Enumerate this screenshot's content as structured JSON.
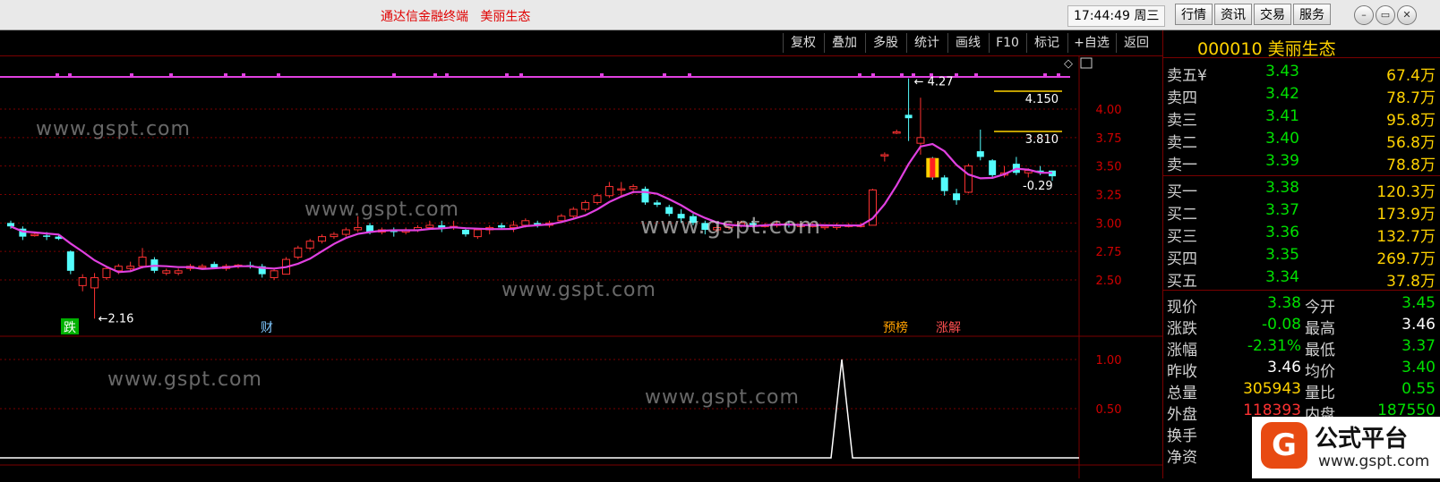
{
  "window": {
    "title": "通达信金融终端   美丽生态",
    "clock": "17:44:49 周三",
    "nav_buttons": [
      "行情",
      "资讯",
      "交易",
      "服务"
    ]
  },
  "toolbar": {
    "buttons": [
      "复权",
      "叠加",
      "多股",
      "统计",
      "画线",
      "F10",
      "标记",
      "+自选",
      "返回"
    ]
  },
  "chart": {
    "price_axis": [
      "4.00",
      "3.75",
      "3.50",
      "3.25",
      "3.00",
      "2.75",
      "2.50"
    ],
    "sub_axis": [
      "1.00",
      "0.50"
    ],
    "annotations": {
      "high": "4.27",
      "low": "2.16",
      "level_upper": "4.150",
      "level_lower": "3.810",
      "change": "-0.29"
    },
    "markers": [
      "跌",
      "财",
      "预榜",
      "涨解"
    ],
    "watermark": "www.gspt.com",
    "colors": {
      "up": "#ff3232",
      "down": "#54fcfc",
      "ma": "#e040e0",
      "grid": "#7a0000"
    }
  },
  "chart_data": {
    "type": "candlestick",
    "ylim": [
      2.25,
      4.35
    ],
    "candles": [
      {
        "o": 3.0,
        "h": 3.02,
        "l": 2.95,
        "c": 2.97
      },
      {
        "o": 2.95,
        "h": 2.97,
        "l": 2.85,
        "c": 2.88
      },
      {
        "o": 2.9,
        "h": 2.92,
        "l": 2.88,
        "c": 2.9
      },
      {
        "o": 2.89,
        "h": 2.92,
        "l": 2.85,
        "c": 2.88
      },
      {
        "o": 2.88,
        "h": 2.9,
        "l": 2.85,
        "c": 2.86
      },
      {
        "o": 2.75,
        "h": 2.76,
        "l": 2.55,
        "c": 2.58
      },
      {
        "o": 2.45,
        "h": 2.55,
        "l": 2.4,
        "c": 2.52
      },
      {
        "o": 2.43,
        "h": 2.56,
        "l": 2.16,
        "c": 2.52
      },
      {
        "o": 2.52,
        "h": 2.62,
        "l": 2.5,
        "c": 2.6
      },
      {
        "o": 2.58,
        "h": 2.64,
        "l": 2.55,
        "c": 2.62
      },
      {
        "o": 2.6,
        "h": 2.66,
        "l": 2.58,
        "c": 2.62
      },
      {
        "o": 2.62,
        "h": 2.78,
        "l": 2.6,
        "c": 2.7
      },
      {
        "o": 2.68,
        "h": 2.7,
        "l": 2.56,
        "c": 2.58
      },
      {
        "o": 2.56,
        "h": 2.6,
        "l": 2.54,
        "c": 2.58
      },
      {
        "o": 2.56,
        "h": 2.6,
        "l": 2.54,
        "c": 2.58
      },
      {
        "o": 2.6,
        "h": 2.64,
        "l": 2.58,
        "c": 2.62
      },
      {
        "o": 2.62,
        "h": 2.64,
        "l": 2.6,
        "c": 2.62
      },
      {
        "o": 2.64,
        "h": 2.66,
        "l": 2.6,
        "c": 2.61
      },
      {
        "o": 2.6,
        "h": 2.64,
        "l": 2.58,
        "c": 2.62
      },
      {
        "o": 2.62,
        "h": 2.64,
        "l": 2.6,
        "c": 2.63
      },
      {
        "o": 2.63,
        "h": 2.66,
        "l": 2.6,
        "c": 2.62
      },
      {
        "o": 2.62,
        "h": 2.64,
        "l": 2.52,
        "c": 2.55
      },
      {
        "o": 2.52,
        "h": 2.6,
        "l": 2.5,
        "c": 2.58
      },
      {
        "o": 2.55,
        "h": 2.7,
        "l": 2.55,
        "c": 2.68
      },
      {
        "o": 2.7,
        "h": 2.8,
        "l": 2.68,
        "c": 2.78
      },
      {
        "o": 2.78,
        "h": 2.86,
        "l": 2.76,
        "c": 2.84
      },
      {
        "o": 2.84,
        "h": 2.9,
        "l": 2.82,
        "c": 2.88
      },
      {
        "o": 2.88,
        "h": 2.92,
        "l": 2.86,
        "c": 2.9
      },
      {
        "o": 2.9,
        "h": 2.96,
        "l": 2.88,
        "c": 2.94
      },
      {
        "o": 2.94,
        "h": 3.06,
        "l": 2.92,
        "c": 2.96
      },
      {
        "o": 2.98,
        "h": 3.0,
        "l": 2.9,
        "c": 2.92
      },
      {
        "o": 2.92,
        "h": 2.96,
        "l": 2.9,
        "c": 2.94
      },
      {
        "o": 2.94,
        "h": 2.96,
        "l": 2.88,
        "c": 2.92
      },
      {
        "o": 2.92,
        "h": 2.96,
        "l": 2.9,
        "c": 2.94
      },
      {
        "o": 2.94,
        "h": 2.98,
        "l": 2.92,
        "c": 2.96
      },
      {
        "o": 2.96,
        "h": 3.02,
        "l": 2.94,
        "c": 2.98
      },
      {
        "o": 2.98,
        "h": 3.02,
        "l": 2.92,
        "c": 2.96
      },
      {
        "o": 2.96,
        "h": 3.02,
        "l": 2.94,
        "c": 2.97
      },
      {
        "o": 2.94,
        "h": 2.96,
        "l": 2.88,
        "c": 2.9
      },
      {
        "o": 2.88,
        "h": 2.95,
        "l": 2.86,
        "c": 2.94
      },
      {
        "o": 2.94,
        "h": 2.98,
        "l": 2.9,
        "c": 2.96
      },
      {
        "o": 2.98,
        "h": 3.0,
        "l": 2.94,
        "c": 2.96
      },
      {
        "o": 2.96,
        "h": 3.02,
        "l": 2.92,
        "c": 2.98
      },
      {
        "o": 2.98,
        "h": 3.04,
        "l": 2.96,
        "c": 3.02
      },
      {
        "o": 3.0,
        "h": 3.02,
        "l": 2.96,
        "c": 2.98
      },
      {
        "o": 2.98,
        "h": 3.02,
        "l": 2.96,
        "c": 3.0
      },
      {
        "o": 3.02,
        "h": 3.08,
        "l": 3.0,
        "c": 3.06
      },
      {
        "o": 3.06,
        "h": 3.14,
        "l": 3.04,
        "c": 3.12
      },
      {
        "o": 3.12,
        "h": 3.2,
        "l": 3.1,
        "c": 3.18
      },
      {
        "o": 3.18,
        "h": 3.26,
        "l": 3.16,
        "c": 3.24
      },
      {
        "o": 3.24,
        "h": 3.36,
        "l": 3.22,
        "c": 3.32
      },
      {
        "o": 3.3,
        "h": 3.36,
        "l": 3.24,
        "c": 3.3
      },
      {
        "o": 3.3,
        "h": 3.34,
        "l": 3.26,
        "c": 3.32
      },
      {
        "o": 3.3,
        "h": 3.32,
        "l": 3.16,
        "c": 3.18
      },
      {
        "o": 3.18,
        "h": 3.2,
        "l": 3.14,
        "c": 3.16
      },
      {
        "o": 3.14,
        "h": 3.16,
        "l": 3.06,
        "c": 3.08
      },
      {
        "o": 3.08,
        "h": 3.12,
        "l": 3.0,
        "c": 3.04
      },
      {
        "o": 3.06,
        "h": 3.08,
        "l": 2.98,
        "c": 3.0
      },
      {
        "o": 3.0,
        "h": 3.02,
        "l": 2.9,
        "c": 2.94
      },
      {
        "o": 2.94,
        "h": 2.98,
        "l": 2.92,
        "c": 2.96
      },
      {
        "o": 2.96,
        "h": 3.0,
        "l": 2.94,
        "c": 2.98
      },
      {
        "o": 2.98,
        "h": 3.02,
        "l": 2.96,
        "c": 3.0
      },
      {
        "o": 3.0,
        "h": 3.02,
        "l": 2.96,
        "c": 2.98
      },
      {
        "o": 2.98,
        "h": 3.0,
        "l": 2.96,
        "c": 2.98
      },
      {
        "o": 2.98,
        "h": 3.02,
        "l": 2.96,
        "c": 2.99
      },
      {
        "o": 2.99,
        "h": 3.02,
        "l": 2.96,
        "c": 2.98
      },
      {
        "o": 2.98,
        "h": 3.0,
        "l": 2.96,
        "c": 2.98
      },
      {
        "o": 2.98,
        "h": 3.0,
        "l": 2.96,
        "c": 2.98
      },
      {
        "o": 2.96,
        "h": 2.98,
        "l": 2.94,
        "c": 2.97
      },
      {
        "o": 2.96,
        "h": 3.0,
        "l": 2.94,
        "c": 2.98
      },
      {
        "o": 2.98,
        "h": 3.0,
        "l": 2.96,
        "c": 2.98
      },
      {
        "o": 2.98,
        "h": 3.0,
        "l": 2.96,
        "c": 2.98
      },
      {
        "o": 2.98,
        "h": 3.3,
        "l": 2.98,
        "c": 3.29
      },
      {
        "o": 3.6,
        "h": 3.62,
        "l": 3.54,
        "c": 3.6
      },
      {
        "o": 3.8,
        "h": 3.82,
        "l": 3.78,
        "c": 3.8
      },
      {
        "o": 3.95,
        "h": 4.27,
        "l": 3.72,
        "c": 3.92
      },
      {
        "o": 3.7,
        "h": 4.1,
        "l": 3.6,
        "c": 3.75
      },
      {
        "o": 3.57,
        "h": 3.58,
        "l": 3.38,
        "c": 3.4
      },
      {
        "o": 3.4,
        "h": 3.42,
        "l": 3.24,
        "c": 3.28
      },
      {
        "o": 3.26,
        "h": 3.3,
        "l": 3.16,
        "c": 3.2
      },
      {
        "o": 3.27,
        "h": 3.52,
        "l": 3.26,
        "c": 3.5
      },
      {
        "o": 3.63,
        "h": 3.82,
        "l": 3.55,
        "c": 3.58
      },
      {
        "o": 3.55,
        "h": 3.56,
        "l": 3.4,
        "c": 3.42
      },
      {
        "o": 3.42,
        "h": 3.5,
        "l": 3.4,
        "c": 3.44
      },
      {
        "o": 3.52,
        "h": 3.58,
        "l": 3.42,
        "c": 3.44
      },
      {
        "o": 3.44,
        "h": 3.48,
        "l": 3.4,
        "c": 3.46
      },
      {
        "o": 3.46,
        "h": 3.5,
        "l": 3.42,
        "c": 3.45
      },
      {
        "o": 3.46,
        "h": 3.46,
        "l": 3.37,
        "c": 3.41
      }
    ]
  },
  "quote": {
    "code": "000010",
    "name": "美丽生态",
    "asks": [
      {
        "label": "卖五",
        "price": "3.43",
        "vol": "67.4万"
      },
      {
        "label": "卖四",
        "price": "3.42",
        "vol": "78.7万"
      },
      {
        "label": "卖三",
        "price": "3.41",
        "vol": "95.8万"
      },
      {
        "label": "卖二",
        "price": "3.40",
        "vol": "56.8万"
      },
      {
        "label": "卖一",
        "price": "3.39",
        "vol": "78.8万"
      }
    ],
    "bids": [
      {
        "label": "买一",
        "price": "3.38",
        "vol": "120.3万"
      },
      {
        "label": "买二",
        "price": "3.37",
        "vol": "173.9万"
      },
      {
        "label": "买三",
        "price": "3.36",
        "vol": "132.7万"
      },
      {
        "label": "买四",
        "price": "3.35",
        "vol": "269.7万"
      },
      {
        "label": "买五",
        "price": "3.34",
        "vol": "37.8万"
      }
    ],
    "yen": "¥",
    "info": [
      {
        "l": "现价",
        "v": "3.38",
        "vc": "#00e000",
        "l2": "今开",
        "v2": "3.45",
        "v2c": "#00e000"
      },
      {
        "l": "涨跌",
        "v": "-0.08",
        "vc": "#00e000",
        "l2": "最高",
        "v2": "3.46",
        "v2c": "#ffffff"
      },
      {
        "l": "涨幅",
        "v": "-2.31%",
        "vc": "#00e000",
        "l2": "最低",
        "v2": "3.37",
        "v2c": "#00e000"
      },
      {
        "l": "昨收",
        "v": "3.46",
        "vc": "#ffffff",
        "l2": "均价",
        "v2": "3.40",
        "v2c": "#00e000"
      },
      {
        "l": "总量",
        "v": "305943",
        "vc": "#ffd200",
        "l2": "量比",
        "v2": "0.55",
        "v2c": "#00e000"
      },
      {
        "l": "外盘",
        "v": "118393",
        "vc": "#ff3232",
        "l2": "内盘",
        "v2": "187550",
        "v2c": "#00e000"
      },
      {
        "l": "换手",
        "v": "",
        "vc": "#ffd200",
        "l2": "",
        "v2": "",
        "v2c": "#ffffff"
      },
      {
        "l": "净资",
        "v": "",
        "vc": "#ffd200",
        "l2": "",
        "v2": "",
        "v2c": "#ffffff"
      }
    ]
  },
  "logo": {
    "mark": "G",
    "name": "公式平台",
    "url": "www.gspt.com"
  }
}
